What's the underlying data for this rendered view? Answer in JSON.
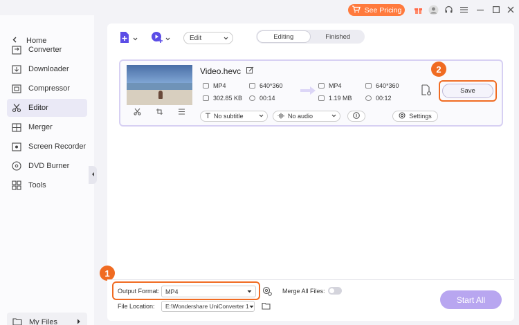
{
  "topbar": {
    "pricing_label": "See Pricing",
    "icons": [
      "gift-icon",
      "avatar-icon",
      "headset-icon",
      "menu-icon",
      "minimize-icon",
      "maximize-icon",
      "close-icon"
    ]
  },
  "sidebar": {
    "home": "Home",
    "items": [
      {
        "label": "Converter",
        "icon": "converter-icon"
      },
      {
        "label": "Downloader",
        "icon": "downloader-icon"
      },
      {
        "label": "Compressor",
        "icon": "compressor-icon"
      },
      {
        "label": "Editor",
        "icon": "editor-icon",
        "active": true
      },
      {
        "label": "Merger",
        "icon": "merger-icon"
      },
      {
        "label": "Screen Recorder",
        "icon": "screen-recorder-icon"
      },
      {
        "label": "DVD Burner",
        "icon": "dvd-burner-icon"
      },
      {
        "label": "Tools",
        "icon": "tools-icon"
      }
    ],
    "my_files": "My Files"
  },
  "toolbar": {
    "edit_value": "Edit",
    "tabs": [
      "Editing",
      "Finished"
    ],
    "active_tab": "Editing"
  },
  "file": {
    "name": "Video.hevc",
    "source": {
      "format": "MP4",
      "resolution": "640*360",
      "size": "302.85 KB",
      "duration": "00:14"
    },
    "target": {
      "format": "MP4",
      "resolution": "640*360",
      "size": "1.19 MB",
      "duration": "00:12"
    },
    "save_label": "Save",
    "subtitle": "No subtitle",
    "audio": "No audio",
    "settings_label": "Settings"
  },
  "steps": {
    "one": "1",
    "two": "2"
  },
  "bottom": {
    "output_format_label": "Output Format:",
    "output_format_value": "MP4",
    "merge_label": "Merge All Files:",
    "merge_on": false,
    "file_location_label": "File Location:",
    "file_location_value": "E:\\Wondershare UniConverter 1",
    "start_all": "Start All"
  },
  "colors": {
    "accent": "#5b4de6",
    "highlight": "#f06b22",
    "start": "#b8a6f0"
  }
}
